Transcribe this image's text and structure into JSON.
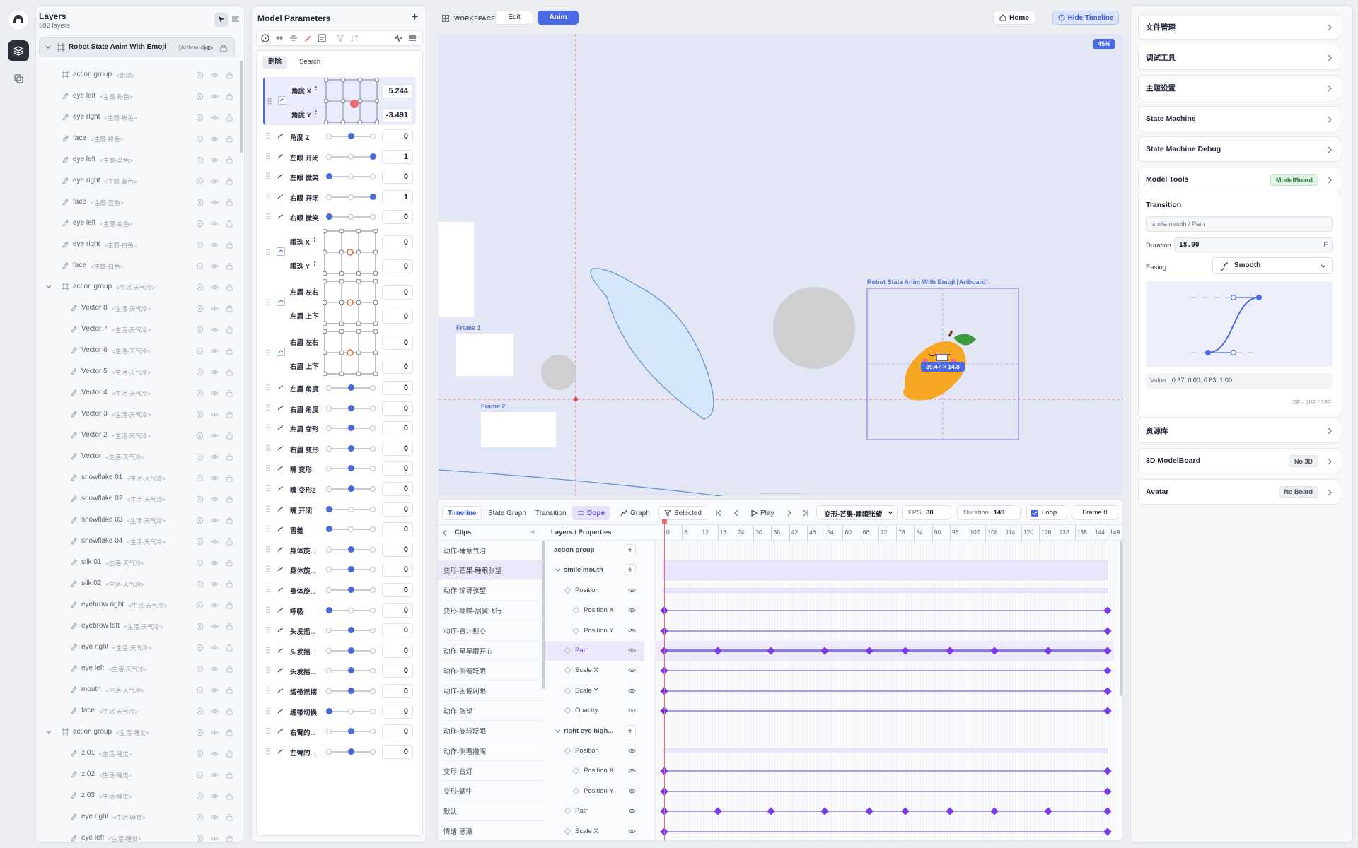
{
  "layers": {
    "title": "Layers",
    "count": "302 layers",
    "root": {
      "name": "Robot State Anim With Emoji",
      "tag": "[Artboard]"
    },
    "rows": [
      {
        "name": "action group",
        "sfx": "<跳动>",
        "indent": 1,
        "type": "group"
      },
      {
        "name": "eye left",
        "sfx": "<主题-粉色>",
        "indent": 1,
        "type": "path"
      },
      {
        "name": "eye right",
        "sfx": "<主题-粉色>",
        "indent": 1,
        "type": "path"
      },
      {
        "name": "face",
        "sfx": "<主题-粉色>",
        "indent": 1,
        "type": "path"
      },
      {
        "name": "eye left",
        "sfx": "<主题-蓝色>",
        "indent": 1,
        "type": "path"
      },
      {
        "name": "eye right",
        "sfx": "<主题-蓝色>",
        "indent": 1,
        "type": "path"
      },
      {
        "name": "face",
        "sfx": "<主题-蓝色>",
        "indent": 1,
        "type": "path"
      },
      {
        "name": "eye left",
        "sfx": "<主题-白色>",
        "indent": 1,
        "type": "path"
      },
      {
        "name": "eye right",
        "sfx": "<主题-白色>",
        "indent": 1,
        "type": "path"
      },
      {
        "name": "face",
        "sfx": "<主题-白色>",
        "indent": 1,
        "type": "path"
      },
      {
        "name": "action group",
        "sfx": "<生活-天气冷>",
        "indent": 1,
        "type": "group-open"
      },
      {
        "name": "Vector 8",
        "sfx": "<生活-天气冷>",
        "indent": 2,
        "type": "path"
      },
      {
        "name": "Vector 7",
        "sfx": "<生活-天气冷>",
        "indent": 2,
        "type": "path"
      },
      {
        "name": "Vector 6",
        "sfx": "<生活-天气冷>",
        "indent": 2,
        "type": "path"
      },
      {
        "name": "Vector 5",
        "sfx": "<生活-天气冷>",
        "indent": 2,
        "type": "path"
      },
      {
        "name": "Vector 4",
        "sfx": "<生活-天气冷>",
        "indent": 2,
        "type": "path"
      },
      {
        "name": "Vector 3",
        "sfx": "<生活-天气冷>",
        "indent": 2,
        "type": "path"
      },
      {
        "name": "Vector 2",
        "sfx": "<生活-天气冷>",
        "indent": 2,
        "type": "path"
      },
      {
        "name": "Vector",
        "sfx": "<生活-天气冷>",
        "indent": 2,
        "type": "path"
      },
      {
        "name": "snowflake 01",
        "sfx": "<生活-天气冷>",
        "indent": 2,
        "type": "path"
      },
      {
        "name": "snowflake 02",
        "sfx": "<生活-天气冷>",
        "indent": 2,
        "type": "path"
      },
      {
        "name": "snowflake 03",
        "sfx": "<生活-天气冷>",
        "indent": 2,
        "type": "path"
      },
      {
        "name": "snowflake 04",
        "sfx": "<生活-天气冷>",
        "indent": 2,
        "type": "path"
      },
      {
        "name": "silk 01",
        "sfx": "<生活-天气冷>",
        "indent": 2,
        "type": "path"
      },
      {
        "name": "silk 02",
        "sfx": "<生活-天气冷>",
        "indent": 2,
        "type": "path"
      },
      {
        "name": "eyebrow right",
        "sfx": "<生活-天气冷>",
        "indent": 2,
        "type": "path"
      },
      {
        "name": "eyebrow left",
        "sfx": "<生活-天气冷>",
        "indent": 2,
        "type": "path"
      },
      {
        "name": "eye right",
        "sfx": "<生活-天气冷>",
        "indent": 2,
        "type": "path"
      },
      {
        "name": "eye left",
        "sfx": "<生活-天气冷>",
        "indent": 2,
        "type": "path"
      },
      {
        "name": "mouth",
        "sfx": "<生活-天气冷>",
        "indent": 2,
        "type": "path"
      },
      {
        "name": "face",
        "sfx": "<生活-天气冷>",
        "indent": 2,
        "type": "path"
      },
      {
        "name": "action group",
        "sfx": "<生活-睡觉>",
        "indent": 1,
        "type": "group-open"
      },
      {
        "name": "z 01",
        "sfx": "<生活-睡觉>",
        "indent": 2,
        "type": "path"
      },
      {
        "name": "z 02",
        "sfx": "<生活-睡觉>",
        "indent": 2,
        "type": "path"
      },
      {
        "name": "z 03",
        "sfx": "<生活-睡觉>",
        "indent": 2,
        "type": "path"
      },
      {
        "name": "eye right",
        "sfx": "<生活-睡觉>",
        "indent": 2,
        "type": "path"
      },
      {
        "name": "eye left",
        "sfx": "<生活-睡觉>",
        "indent": 2,
        "type": "path"
      }
    ]
  },
  "params": {
    "title": "Model Parameters",
    "tabs": [
      "删除",
      "Search"
    ],
    "rows": [
      {
        "kind": "pad",
        "labels": [
          "角度 X",
          "角度 Y"
        ],
        "values": [
          "5.244",
          "-3.491"
        ],
        "highlight": true,
        "dot": "red"
      },
      {
        "kind": "slider",
        "label": "角度 Z",
        "value": "0",
        "pos": 0.5
      },
      {
        "kind": "slider",
        "label": "左眼 开闭",
        "value": "1",
        "pos": 1
      },
      {
        "kind": "slider",
        "label": "左眼 微笑",
        "value": "0",
        "pos": 0
      },
      {
        "kind": "slider",
        "label": "右眼 开闭",
        "value": "1",
        "pos": 1
      },
      {
        "kind": "slider",
        "label": "右眼 微笑",
        "value": "0",
        "pos": 0
      },
      {
        "kind": "pad",
        "labels": [
          "眼珠 X",
          "眼珠 Y"
        ],
        "values": [
          "0",
          "0"
        ],
        "dot": "ring"
      },
      {
        "kind": "pad",
        "labels": [
          "左眉 左右",
          "左眉 上下"
        ],
        "values": [
          "0",
          "0"
        ],
        "dot": "ring"
      },
      {
        "kind": "pad",
        "labels": [
          "右眉 左右",
          "右眉 上下"
        ],
        "values": [
          "0",
          "0"
        ],
        "dot": "ring"
      },
      {
        "kind": "slider",
        "label": "左眉 角度",
        "value": "0",
        "pos": 0.5
      },
      {
        "kind": "slider",
        "label": "右眉 角度",
        "value": "0",
        "pos": 0.5
      },
      {
        "kind": "slider",
        "label": "左眉 变形",
        "value": "0",
        "pos": 0.5
      },
      {
        "kind": "slider",
        "label": "右眉 变形",
        "value": "0",
        "pos": 0.5
      },
      {
        "kind": "slider",
        "label": "嘴 变形",
        "value": "0",
        "pos": 0.5
      },
      {
        "kind": "slider",
        "label": "嘴 变形2",
        "value": "0",
        "pos": 0.5
      },
      {
        "kind": "slider",
        "label": "嘴 开闭",
        "value": "0",
        "pos": 0
      },
      {
        "kind": "slider",
        "label": "害羞",
        "value": "0",
        "pos": 0
      },
      {
        "kind": "slider",
        "label": "身体旋...",
        "value": "0",
        "pos": 0.5
      },
      {
        "kind": "slider",
        "label": "身体旋...",
        "value": "0",
        "pos": 0.5
      },
      {
        "kind": "slider",
        "label": "身体旋...",
        "value": "0",
        "pos": 0.5
      },
      {
        "kind": "slider",
        "label": "呼吸",
        "value": "0",
        "pos": 0
      },
      {
        "kind": "slider",
        "label": "头发摇...",
        "value": "0",
        "pos": 0.5
      },
      {
        "kind": "slider",
        "label": "头发摇...",
        "value": "0",
        "pos": 0.5
      },
      {
        "kind": "slider",
        "label": "头发摇...",
        "value": "0",
        "pos": 0.5
      },
      {
        "kind": "slider",
        "label": "缎带摇摆",
        "value": "0",
        "pos": 0.5
      },
      {
        "kind": "slider",
        "label": "缎带切换",
        "value": "0",
        "pos": 0
      },
      {
        "kind": "slider",
        "label": "右臂的...",
        "value": "0",
        "pos": 0.5
      },
      {
        "kind": "slider",
        "label": "左臂的...",
        "value": "0",
        "pos": 0.5
      }
    ]
  },
  "workspace": {
    "label": "WORKSPACE",
    "modes": [
      "Edit",
      "Anim"
    ],
    "home": "Home",
    "hide_timeline": "Hide Timeline",
    "zoom": "45%",
    "artboard_label": "Robot State Anim With Emoji [Artboard]",
    "frame1": "Frame 1",
    "frame2": "Frame 2",
    "size_readout": "39.47 × 14.8"
  },
  "timeline": {
    "tabs": [
      "Timeline",
      "State Graph",
      "Transition",
      "Dope",
      "Graph",
      "Selected"
    ],
    "play": "Play",
    "clip_select": "变形-芒果-睡眼张望",
    "fps_label": "FPS",
    "fps": "30",
    "duration_label": "Duration",
    "duration": "149",
    "loop": "Loop",
    "frame": "Frame 0",
    "clips_header": "Clips",
    "props_header": "Layers / Properties",
    "ruler": [
      "0",
      "6",
      "12",
      "18",
      "24",
      "30",
      "36",
      "42",
      "48",
      "54",
      "60",
      "66",
      "72",
      "78",
      "84",
      "90",
      "96",
      "102",
      "108",
      "114",
      "120",
      "126",
      "132",
      "138",
      "144",
      "149"
    ],
    "clips": [
      "动作-睡意气泡",
      "变形-芒果-睡眼张望",
      "动作-惊讶张望",
      "变形-蝴蝶-扇翼飞行",
      "动作-冒汗担心",
      "动作-星星眼开心",
      "动作-侧看眨眼",
      "动作-困倦闭眼",
      "动作-张望",
      "动作-旋转眨眼",
      "动作-侧看撇嘴",
      "变形-台灯",
      "变形-蜗牛",
      "默认",
      "情绪-感激"
    ],
    "props": [
      {
        "label": "action group",
        "kind": "group"
      },
      {
        "label": "smile mouth",
        "kind": "layer"
      },
      {
        "label": "Position",
        "kind": "prop"
      },
      {
        "label": "Position X",
        "kind": "sub"
      },
      {
        "label": "Position Y",
        "kind": "sub"
      },
      {
        "label": "Path",
        "kind": "prop-active"
      },
      {
        "label": "Scale X",
        "kind": "prop"
      },
      {
        "label": "Scale Y",
        "kind": "prop"
      },
      {
        "label": "Opacity",
        "kind": "prop"
      },
      {
        "label": "right eye high...",
        "kind": "layer"
      },
      {
        "label": "Position",
        "kind": "prop"
      },
      {
        "label": "Position X",
        "kind": "sub"
      },
      {
        "label": "Position Y",
        "kind": "sub"
      },
      {
        "label": "Path",
        "kind": "prop"
      },
      {
        "label": "Scale X",
        "kind": "prop"
      }
    ],
    "tracks": [
      {
        "type": "none"
      },
      {
        "type": "band"
      },
      {
        "type": "band"
      },
      {
        "type": "ends"
      },
      {
        "type": "ends"
      },
      {
        "type": "path"
      },
      {
        "type": "ends"
      },
      {
        "type": "ends"
      },
      {
        "type": "ends"
      },
      {
        "type": "none"
      },
      {
        "type": "band"
      },
      {
        "type": "ends"
      },
      {
        "type": "ends"
      },
      {
        "type": "path"
      },
      {
        "type": "ends"
      }
    ],
    "path_keys": [
      0,
      18,
      36,
      54,
      69,
      81,
      96,
      111,
      129,
      149
    ]
  },
  "right": {
    "items_top": [
      {
        "label": "文件管理"
      },
      {
        "label": "调试工具"
      },
      {
        "label": "主题设置"
      },
      {
        "label": "State Machine"
      },
      {
        "label": "State Machine Debug"
      },
      {
        "label": "Model Tools",
        "badge": "ModelBoard"
      }
    ],
    "transition": {
      "title": "Transition",
      "target": "smile mouth / Path",
      "duration_label": "Duration",
      "duration": "18.00",
      "unit": "F",
      "easing_label": "Easing",
      "easing": "Smooth",
      "value_label": "Value",
      "value": "0.37, 0.00, 0.63, 1.00",
      "range": "0F - 18F / 18F"
    },
    "items_bottom": [
      {
        "label": "资源库"
      },
      {
        "label": "3D ModelBoard",
        "badge": "No 3D"
      },
      {
        "label": "Avatar",
        "badge": "No Board"
      }
    ]
  }
}
